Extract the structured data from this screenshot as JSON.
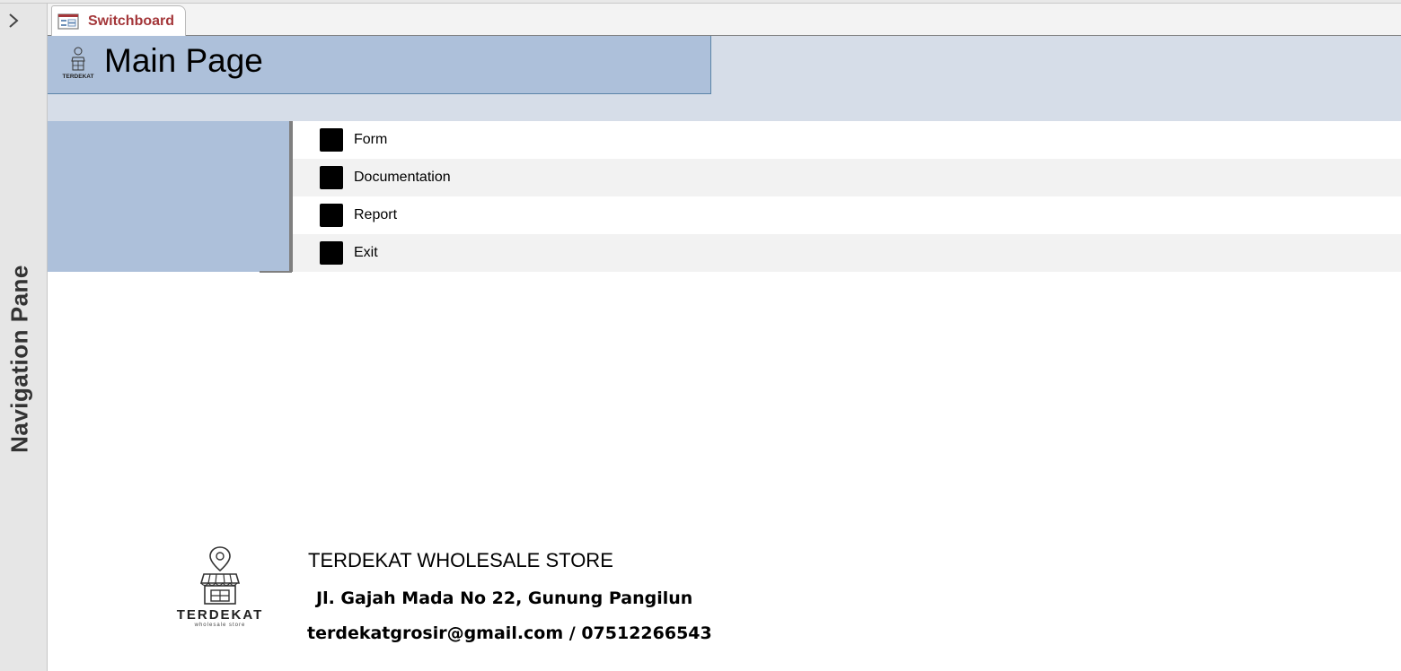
{
  "navigation_pane": {
    "label": "Navigation Pane",
    "toggle_icon": "chevron-right-icon"
  },
  "tab": {
    "label": "Switchboard",
    "icon": "form-icon",
    "color": "#a4373a"
  },
  "header": {
    "title": "Main Page",
    "logo_text": "TERDEKAT",
    "accent": "#adc0da"
  },
  "menu": {
    "items": [
      {
        "label": "Form"
      },
      {
        "label": "Documentation"
      },
      {
        "label": "Report"
      },
      {
        "label": "Exit"
      }
    ]
  },
  "footer": {
    "logo_name": "TERDEKAT",
    "logo_tagline": "wholesale store",
    "store_name": "TERDEKAT WHOLESALE STORE",
    "address": "Jl. Gajah Mada No 22, Gunung Pangilun",
    "contact": "terdekatgrosir@gmail.com / 07512266543"
  }
}
